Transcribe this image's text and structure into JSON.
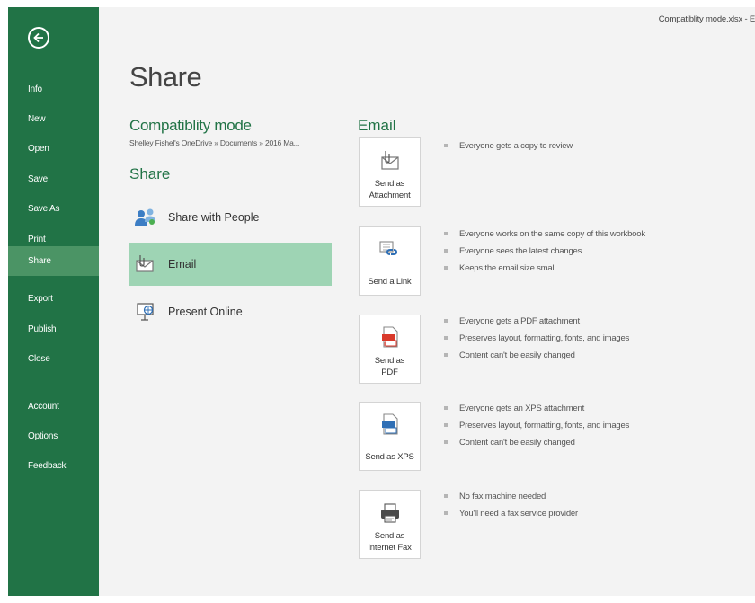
{
  "window": {
    "title": "Compatiblity mode.xlsx - E"
  },
  "sidebar": {
    "back_label": "back",
    "items": [
      {
        "label": "Info"
      },
      {
        "label": "New"
      },
      {
        "label": "Open"
      },
      {
        "label": "Save"
      },
      {
        "label": "Save As"
      },
      {
        "label": "Print"
      },
      {
        "label": "Share"
      },
      {
        "label": "Export"
      },
      {
        "label": "Publish"
      },
      {
        "label": "Close"
      },
      {
        "label": "Account"
      },
      {
        "label": "Options"
      },
      {
        "label": "Feedback"
      }
    ],
    "active": "Share"
  },
  "main": {
    "title": "Share",
    "doc_name": "Compatiblity mode",
    "doc_path": "Shelley Fishel's OneDrive » Documents » 2016 Ma...",
    "share_heading": "Share",
    "share_options": [
      {
        "label": "Share with People",
        "icon": "people-icon"
      },
      {
        "label": "Email",
        "icon": "email-icon"
      },
      {
        "label": "Present Online",
        "icon": "present-online-icon"
      }
    ],
    "selected_option": "Email"
  },
  "email_panel": {
    "heading": "Email",
    "actions": [
      {
        "label": "Send as\nAttachment",
        "icon": "attachment-icon",
        "bullets": [
          "Everyone gets a copy to review"
        ]
      },
      {
        "label": "Send a Link",
        "icon": "link-icon",
        "bullets": [
          "Everyone works on the same copy of this workbook",
          "Everyone sees the latest changes",
          "Keeps the email size small"
        ]
      },
      {
        "label": "Send as\nPDF",
        "icon": "pdf-icon",
        "bullets": [
          "Everyone gets a PDF attachment",
          "Preserves layout, formatting, fonts, and images",
          "Content can't be easily changed"
        ]
      },
      {
        "label": "Send as XPS",
        "icon": "xps-icon",
        "bullets": [
          "Everyone gets an XPS attachment",
          "Preserves layout, formatting, fonts, and images",
          "Content can't be easily changed"
        ]
      },
      {
        "label": "Send as\nInternet Fax",
        "icon": "fax-icon",
        "bullets": [
          "No fax machine needed",
          "You'll need a fax service provider"
        ]
      }
    ]
  },
  "colors": {
    "accent": "#217346",
    "selected": "#9ed4b4",
    "sidebar_active": "#4b9465"
  }
}
